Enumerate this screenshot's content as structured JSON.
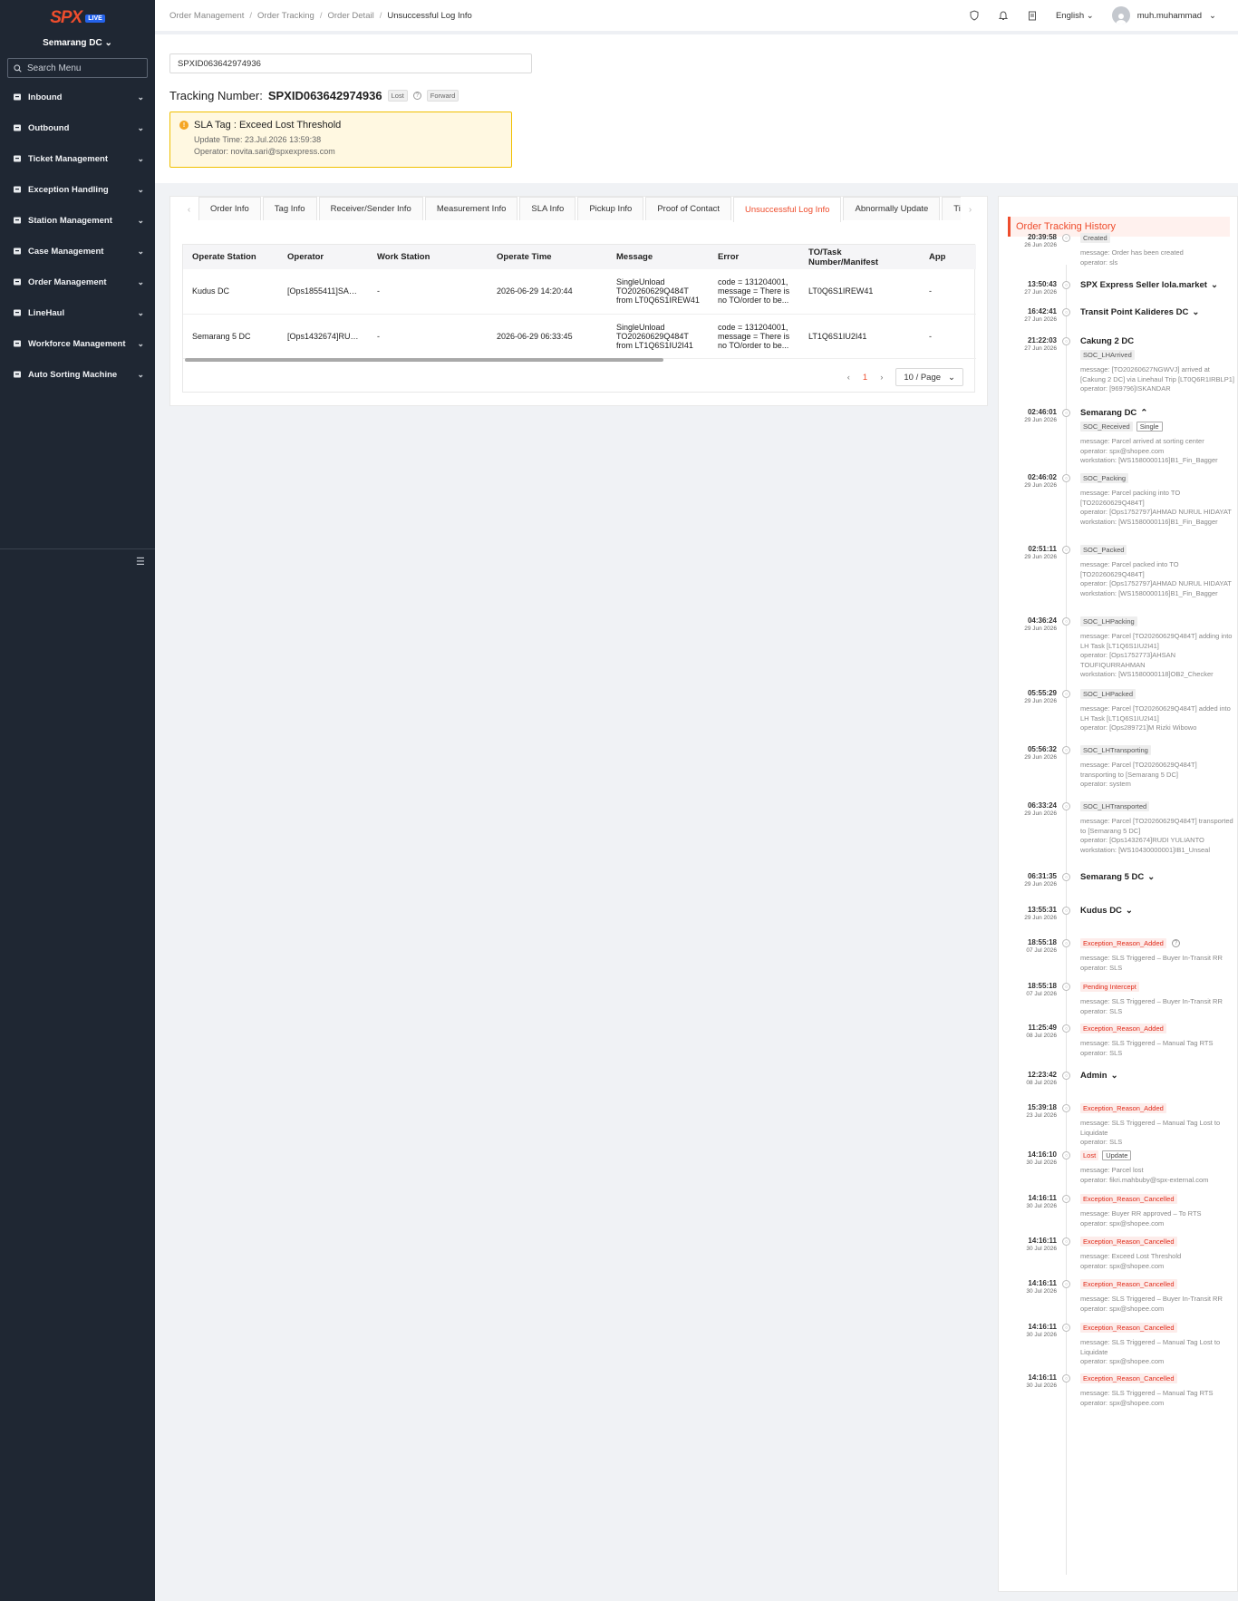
{
  "sidebar": {
    "logo": "SPX",
    "logo_badge": "LIVE",
    "station": "Semarang DC",
    "search_placeholder": "Search Menu",
    "items": [
      {
        "label": "Inbound"
      },
      {
        "label": "Outbound"
      },
      {
        "label": "Ticket Management"
      },
      {
        "label": "Exception Handling"
      },
      {
        "label": "Station Management"
      },
      {
        "label": "Case Management"
      },
      {
        "label": "Order Management"
      },
      {
        "label": "LineHaul"
      },
      {
        "label": "Workforce Management"
      },
      {
        "label": "Auto Sorting Machine"
      }
    ]
  },
  "header": {
    "breadcrumb": [
      "Order Management",
      "Order Tracking",
      "Order Detail",
      "Unsuccessful Log Info"
    ],
    "language": "English",
    "user": "muh.muhammad"
  },
  "search": {
    "value": "SPXID063642974936"
  },
  "tracking": {
    "label": "Tracking Number:",
    "number": "SPXID063642974936",
    "tag_lost": "Lost",
    "tag_forward": "Forward"
  },
  "sla": {
    "title": "SLA Tag : Exceed Lost Threshold",
    "update_time": "Update Time: 23.Jul.2026 13:59:38",
    "operator": "Operator: novita.sari@spxexpress.com"
  },
  "tabs": [
    "Order Info",
    "Tag Info",
    "Receiver/Sender Info",
    "Measurement Info",
    "SLA Info",
    "Pickup Info",
    "Proof of Contact",
    "Unsuccessful Log Info",
    "Abnormally Update",
    "Ticket Log"
  ],
  "active_tab": "Unsuccessful Log Info",
  "table": {
    "headers": [
      "Operate Station",
      "Operator",
      "Work Station",
      "Operate Time",
      "Message",
      "Error",
      "TO/Task Number/Manifest",
      "App"
    ],
    "rows": [
      [
        "Kudus DC",
        "[Ops1855411]SAM...",
        "-",
        "2026-06-29 14:20:44",
        "SingleUnload TO20260629Q484T from LT0Q6S1IREW41",
        "code = 131204001, message = There is no TO/order to be...",
        "LT0Q6S1IREW41",
        "-"
      ],
      [
        "Semarang 5 DC",
        "[Ops1432674]RUDI ...",
        "-",
        "2026-06-29 06:33:45",
        "SingleUnload TO20260629Q484T from LT1Q6S1IU2I41",
        "code = 131204001, message = There is no TO/order to be...",
        "LT1Q6S1IU2I41",
        "-"
      ]
    ]
  },
  "pager": {
    "page": "1",
    "size": "10 / Page"
  },
  "history": {
    "title": "Order Tracking History",
    "events": [
      {
        "time": "20:39:58",
        "date": "26 Jun 2026",
        "tags": [
          {
            "text": "Created",
            "style": "grey"
          }
        ],
        "lines": [
          "message: Order has been created",
          "operator: sls"
        ]
      },
      {
        "time": "13:50:43",
        "date": "27 Jun 2026",
        "title": "SPX Express Seller lola.market",
        "chevron": "down",
        "lines": []
      },
      {
        "time": "16:42:41",
        "date": "27 Jun 2026",
        "title": "Transit Point Kalideres DC",
        "chevron": "down",
        "lines": []
      },
      {
        "time": "21:22:03",
        "date": "27 Jun 2026",
        "title": "Cakung 2 DC",
        "tags": [
          {
            "text": "SOC_LHArrived",
            "style": "grey"
          }
        ],
        "lines": [
          "message: [TO20260627NGWVJ] arrived at [Cakung 2 DC] via Linehaul Trip [LT0Q6R1IRBLP1]",
          "operator: [969796]ISKANDAR"
        ]
      },
      {
        "time": "02:46:01",
        "date": "29 Jun 2026",
        "title": "Semarang DC",
        "chevron": "up",
        "tags": [
          {
            "text": "SOC_Received",
            "style": "grey"
          },
          {
            "text": "Single",
            "style": "outline"
          }
        ],
        "lines": [
          "message: Parcel arrived at sorting center",
          "operator: spx@shopee.com",
          "workstation: [WS1580000116]B1_Fin_Bagger"
        ]
      },
      {
        "time": "02:46:02",
        "date": "29 Jun 2026",
        "tags": [
          {
            "text": "SOC_Packing",
            "style": "grey"
          }
        ],
        "lines": [
          "message: Parcel packing into TO [TO20260629Q484T]",
          "operator: [Ops1752797]AHMAD NURUL HIDAYAT",
          "workstation: [WS1580000116]B1_Fin_Bagger"
        ]
      },
      {
        "time": "02:51:11",
        "date": "29 Jun 2026",
        "tags": [
          {
            "text": "SOC_Packed",
            "style": "grey"
          }
        ],
        "lines": [
          "message: Parcel packed into TO [TO20260629Q484T]",
          "operator: [Ops1752797]AHMAD NURUL HIDAYAT",
          "workstation: [WS1580000116]B1_Fin_Bagger"
        ]
      },
      {
        "time": "04:36:24",
        "date": "29 Jun 2026",
        "tags": [
          {
            "text": "SOC_LHPacking",
            "style": "grey"
          }
        ],
        "lines": [
          "message: Parcel [TO20260629Q484T] adding into LH Task [LT1Q6S1IU2I41]",
          "operator: [Ops1752773]AHSAN TOUFIQURRAHMAN",
          "workstation: [WS1580000118]OB2_Checker"
        ]
      },
      {
        "time": "05:55:29",
        "date": "29 Jun 2026",
        "tags": [
          {
            "text": "SOC_LHPacked",
            "style": "grey"
          }
        ],
        "lines": [
          "message: Parcel [TO20260629Q484T] added into LH Task [LT1Q6S1IU2I41]",
          "operator: [Ops289721]M Rizki Wibowo"
        ]
      },
      {
        "time": "05:56:32",
        "date": "29 Jun 2026",
        "tags": [
          {
            "text": "SOC_LHTransporting",
            "style": "grey"
          }
        ],
        "lines": [
          "message: Parcel [TO20260629Q484T] transporting to [Semarang 5 DC]",
          "operator: system"
        ]
      },
      {
        "time": "06:33:24",
        "date": "29 Jun 2026",
        "tags": [
          {
            "text": "SOC_LHTransported",
            "style": "grey"
          }
        ],
        "lines": [
          "message: Parcel [TO20260629Q484T] transported to [Semarang 5 DC]",
          "operator: [Ops1432674]RUDI YULIANTO",
          "workstation: [WS10430000001]IB1_Unseal"
        ]
      },
      {
        "time": "06:31:35",
        "date": "29 Jun 2026",
        "title": "Semarang 5 DC",
        "chevron": "down",
        "lines": []
      },
      {
        "time": "13:55:31",
        "date": "29 Jun 2026",
        "title": "Kudus DC",
        "chevron": "down",
        "lines": []
      },
      {
        "time": "18:55:18",
        "date": "07 Jul 2026",
        "tags": [
          {
            "text": "Exception_Reason_Added",
            "style": "red"
          }
        ],
        "help": true,
        "lines": [
          "message: SLS Triggered – Buyer In-Transit RR",
          "operator: SLS"
        ]
      },
      {
        "time": "18:55:18",
        "date": "07 Jul 2026",
        "tags": [
          {
            "text": "Pending Intercept",
            "style": "red"
          }
        ],
        "lines": [
          "message: SLS Triggered – Buyer In-Transit RR",
          "operator: SLS"
        ]
      },
      {
        "time": "11:25:49",
        "date": "08 Jul 2026",
        "tags": [
          {
            "text": "Exception_Reason_Added",
            "style": "red"
          }
        ],
        "lines": [
          "message: SLS Triggered – Manual Tag RTS",
          "operator: SLS"
        ]
      },
      {
        "time": "12:23:42",
        "date": "08 Jul 2026",
        "title": "Admin",
        "chevron": "down",
        "lines": []
      },
      {
        "time": "15:39:18",
        "date": "23 Jul 2026",
        "tags": [
          {
            "text": "Exception_Reason_Added",
            "style": "red"
          }
        ],
        "lines": [
          "message: SLS Triggered – Manual Tag Lost to Liquidate",
          "operator: SLS"
        ]
      },
      {
        "time": "14:16:10",
        "date": "30 Jul 2026",
        "tags": [
          {
            "text": "Lost",
            "style": "red"
          },
          {
            "text": "Update",
            "style": "outline"
          }
        ],
        "lines": [
          "message: Parcel lost",
          "operator: fikri.mahbuby@spx-external.com"
        ]
      },
      {
        "time": "14:16:11",
        "date": "30 Jul 2026",
        "tags": [
          {
            "text": "Exception_Reason_Cancelled",
            "style": "red"
          }
        ],
        "lines": [
          "message: Buyer RR approved – To RTS",
          "operator: spx@shopee.com"
        ]
      },
      {
        "time": "14:16:11",
        "date": "30 Jul 2026",
        "tags": [
          {
            "text": "Exception_Reason_Cancelled",
            "style": "red"
          }
        ],
        "lines": [
          "message: Exceed Lost Threshold",
          "operator: spx@shopee.com"
        ]
      },
      {
        "time": "14:16:11",
        "date": "30 Jul 2026",
        "tags": [
          {
            "text": "Exception_Reason_Cancelled",
            "style": "red"
          }
        ],
        "lines": [
          "message: SLS Triggered – Buyer In-Transit RR",
          "operator: spx@shopee.com"
        ]
      },
      {
        "time": "14:16:11",
        "date": "30 Jul 2026",
        "tags": [
          {
            "text": "Exception_Reason_Cancelled",
            "style": "red"
          }
        ],
        "lines": [
          "message: SLS Triggered – Manual Tag Lost to Liquidate",
          "operator: spx@shopee.com"
        ]
      },
      {
        "time": "14:16:11",
        "date": "30 Jul 2026",
        "tags": [
          {
            "text": "Exception_Reason_Cancelled",
            "style": "red"
          }
        ],
        "lines": [
          "message: SLS Triggered – Manual Tag RTS",
          "operator: spx@shopee.com"
        ]
      }
    ]
  },
  "colors": {
    "accent": "#ee4d2d",
    "sidebar": "#1f2733",
    "warning_bg": "#fff8e1",
    "warning_border": "#f0c000"
  }
}
